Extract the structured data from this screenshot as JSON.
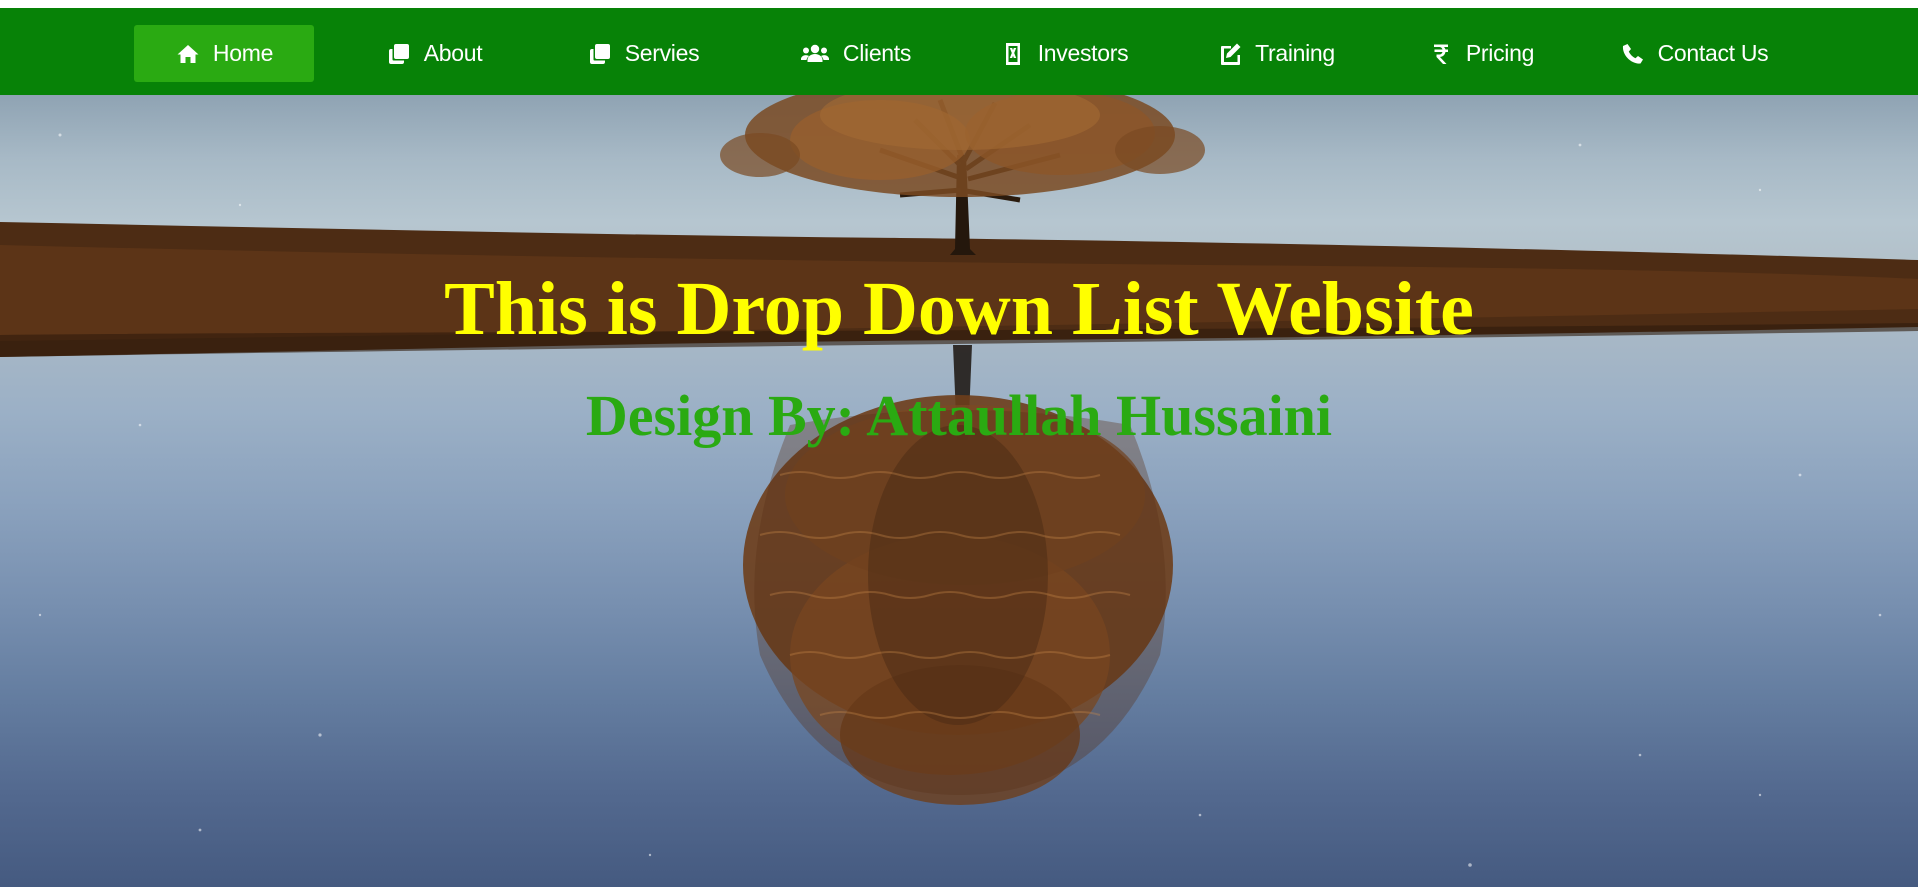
{
  "nav": {
    "items": [
      {
        "label": "Home",
        "icon": "home-icon",
        "active": true
      },
      {
        "label": "About",
        "icon": "clone-icon"
      },
      {
        "label": "Servies",
        "icon": "clone-icon"
      },
      {
        "label": "Clients",
        "icon": "users-icon"
      },
      {
        "label": "Investors",
        "icon": "file-excel-icon"
      },
      {
        "label": "Training",
        "icon": "edit-icon"
      },
      {
        "label": "Pricing",
        "icon": "rupee-icon"
      },
      {
        "label": "Contact Us",
        "icon": "phone-icon"
      }
    ]
  },
  "hero": {
    "title": "This is Drop Down List Website",
    "subtitle": "Design By: Attaullah Hussaini"
  },
  "colors": {
    "nav_bg": "#078207",
    "nav_active_bg": "#2aaa12",
    "title_color": "#ffff00",
    "subtitle_color": "#2aaa12"
  }
}
